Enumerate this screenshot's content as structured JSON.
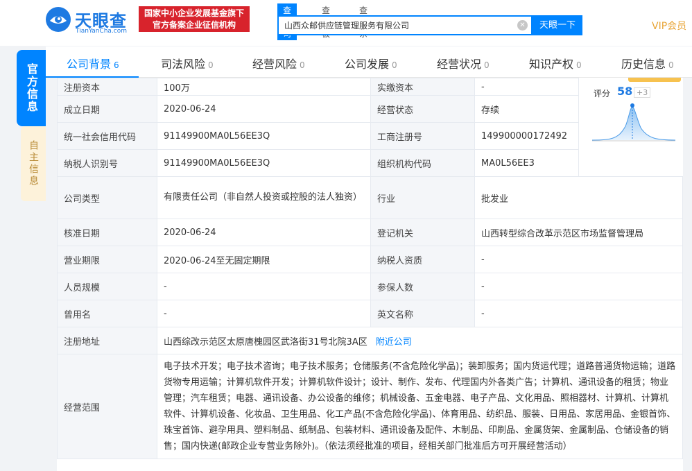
{
  "header": {
    "logo_text": "天眼查",
    "logo_sub": "TianYanCha.com",
    "badge_line1": "国家中小企业发展基金旗下",
    "badge_line2": "官方备案企业征信机构",
    "search_tabs": [
      "查公司",
      "查老板",
      "查关系"
    ],
    "search_value": "山西众邮供应链管理服务有限公司",
    "search_button": "天眼一下",
    "vip": "VIP会员"
  },
  "side_tabs": {
    "official": "官方信息",
    "self": "自主信息"
  },
  "nav": {
    "items": [
      {
        "label": "公司背景",
        "count": "6"
      },
      {
        "label": "司法风险",
        "count": "0"
      },
      {
        "label": "经营风险",
        "count": "0"
      },
      {
        "label": "公司发展",
        "count": "0"
      },
      {
        "label": "经营状况",
        "count": "0"
      },
      {
        "label": "知识产权",
        "count": "0"
      },
      {
        "label": "历史信息",
        "count": "0"
      }
    ]
  },
  "score": {
    "label": "评分",
    "value": "58",
    "delta": "+3"
  },
  "rows": [
    {
      "l1": "注册资本",
      "v1": "100万",
      "l2": "实缴资本",
      "v2": "-"
    },
    {
      "l1": "成立日期",
      "v1": "2020-06-24",
      "l2": "经营状态",
      "v2": "存续"
    },
    {
      "l1": "统一社会信用代码",
      "v1": "91149900MA0L56EE3Q",
      "l2": "工商注册号",
      "v2": "149900000172492"
    },
    {
      "l1": "纳税人识别号",
      "v1": "91149900MA0L56EE3Q",
      "l2": "组织机构代码",
      "v2": "MA0L56EE3"
    },
    {
      "l1": "公司类型",
      "v1": "有限责任公司（非自然人投资或控股的法人独资）",
      "l2": "行业",
      "v2": "批发业"
    },
    {
      "l1": "核准日期",
      "v1": "2020-06-24",
      "l2": "登记机关",
      "v2": "山西转型综合改革示范区市场监督管理局"
    },
    {
      "l1": "营业期限",
      "v1": "2020-06-24至无固定期限",
      "l2": "纳税人资质",
      "v2": "-"
    },
    {
      "l1": "人员规模",
      "v1": "-",
      "l2": "参保人数",
      "v2": "-"
    },
    {
      "l1": "曾用名",
      "v1": "-",
      "l2": "英文名称",
      "v2": "-"
    }
  ],
  "address": {
    "label": "注册地址",
    "value": "山西综改示范区太原唐槐园区武洛街31号北院3A区",
    "link": "附近公司"
  },
  "scope": {
    "label": "经营范围",
    "value": "电子技术开发；电子技术咨询；电子技术服务；仓储服务(不含危险化学品)；装卸服务；国内货运代理；道路普通货物运输；道路货物专用运输；计算机软件开发；计算机软件设计；设计、制作、发布、代理国内外各类广告；计算机、通讯设备的租赁；物业管理；汽车租赁；电器、通讯设备、办公设备的维修；机械设备、五金电器、电子产品、文化用品、照相器材、计算机、计算机软件、计算机设备、化妆品、卫生用品、化工产品(不含危险化学品)、体育用品、纺织品、服装、日用品、家居用品、金银首饰、珠宝首饰、避孕用具、塑料制品、纸制品、包装材料、通讯设备及配件、木制品、印刷品、金属货架、金属制品、仓储设备的销售；国内快递(邮政企业专营业务除外)。（依法须经批准的项目，经相关部门批准后方可开展经营活动）"
  }
}
